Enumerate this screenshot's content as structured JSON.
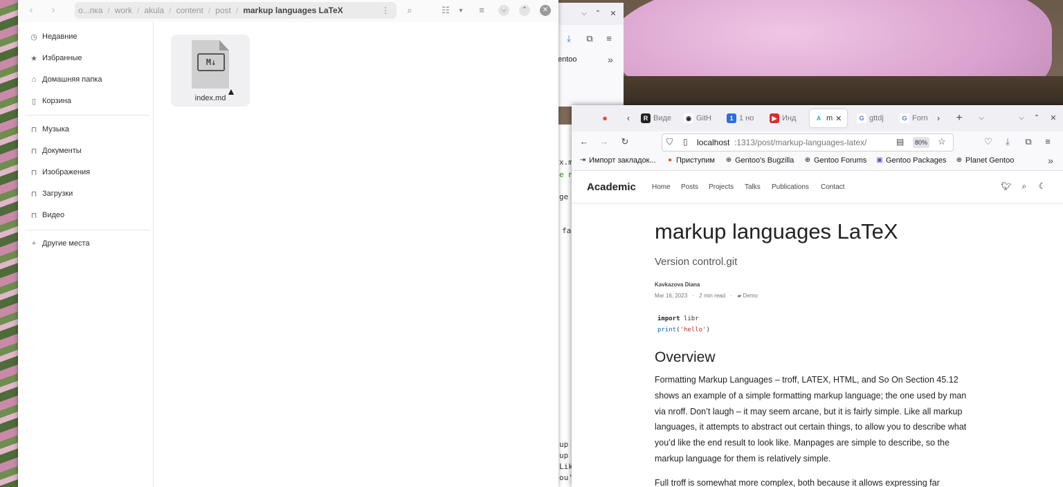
{
  "file_manager": {
    "path": [
      "o...пка",
      "work",
      "akula",
      "content",
      "post",
      "markup languages LaTeX"
    ],
    "sidebar": [
      {
        "label": "Недавние",
        "icon": "clock-icon"
      },
      {
        "label": "Избранные",
        "icon": "star-icon"
      },
      {
        "label": "Домашняя папка",
        "icon": "home-icon"
      },
      {
        "label": "Корзина",
        "icon": "trash-icon"
      },
      {
        "label": "Музыка",
        "icon": "folder-icon"
      },
      {
        "label": "Документы",
        "icon": "folder-icon"
      },
      {
        "label": "Изображения",
        "icon": "folder-icon"
      },
      {
        "label": "Загрузки",
        "icon": "folder-icon"
      },
      {
        "label": "Видео",
        "icon": "folder-icon"
      },
      {
        "label": "Другие места",
        "icon": "plus-icon"
      }
    ],
    "files": [
      {
        "name": "index.md",
        "icon_text": "M↓"
      }
    ]
  },
  "back_window": {
    "bookmark_fragment": "entoo"
  },
  "terminal_fragments": [
    "x.m",
    "e n",
    "ge",
    "fa",
    "up",
    "up",
    "Lik",
    "ou'"
  ],
  "browser": {
    "tabs": [
      {
        "label": "Виде",
        "icon_text": "R"
      },
      {
        "label": "GitH",
        "icon_text": "◉"
      },
      {
        "label": "1 но",
        "icon_text": "1"
      },
      {
        "label": "Инд",
        "icon_text": "▶"
      },
      {
        "label": "m",
        "icon_text": "A",
        "active": true
      },
      {
        "label": "gttdj",
        "icon_text": "G"
      },
      {
        "label": "Forn",
        "icon_text": "G"
      }
    ],
    "url_host": "localhost",
    "url_path": ":1313/post/markup-languages-latex/",
    "zoom": "80%",
    "bookmarks": [
      "Импорт закладок...",
      "Приступим",
      "Gentoo's Bugzilla",
      "Gentoo Forums",
      "Gentoo Packages",
      "Planet Gentoo"
    ]
  },
  "site": {
    "brand": "Academic",
    "nav": [
      "Home",
      "Posts",
      "Projects",
      "Talks",
      "Publications",
      "Contact"
    ]
  },
  "article": {
    "title": "markup languages LaTeX",
    "subtitle": "Version control.git",
    "author": "Kavkazova Diana",
    "date": "Mar 16, 2023",
    "read_time": "2 min read",
    "category": "Demo",
    "code_line1_kw": "import",
    "code_line1_rest": " libr",
    "code_line2_fn": "print",
    "code_line2_open": "(",
    "code_line2_str": "'hello'",
    "code_line2_close": ")",
    "h2": "Overview",
    "p1": "Formatting Markup Languages – troff, LATEX, HTML, and So On Section 45.12 shows an example of a simple formatting markup language; the one used by man via nroff. Don’t laugh – it may seem arcane, but it is fairly simple. Like all markup languages, it attempts to abstract out certain things, to allow you to describe what you’d like the end result to look like. Manpages are simple to describe, so the markup language for them is relatively simple.",
    "p2": "Full troff is somewhat more complex, both because it allows expressing far"
  }
}
